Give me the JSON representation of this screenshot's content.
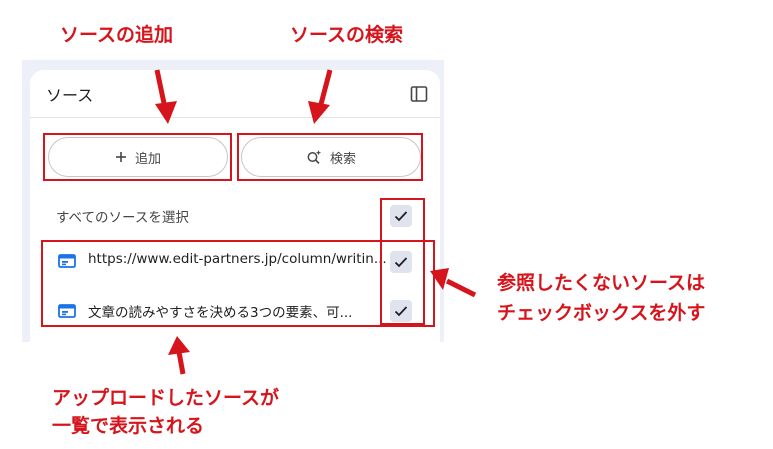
{
  "panel": {
    "title": "ソース",
    "toggle_icon": "panel-toggle-icon"
  },
  "actions": {
    "add_label": "追加",
    "add_icon": "plus-icon",
    "search_label": "検索",
    "search_icon": "sparkle-search-icon"
  },
  "select_all": {
    "label": "すべてのソースを選択",
    "checked": true
  },
  "sources": [
    {
      "title": "https://www.edit-partners.jp/column/writin...",
      "icon": "web-source-icon",
      "checked": true
    },
    {
      "title": "文章の読みやすさを決める3つの要素、可...",
      "icon": "web-source-icon",
      "checked": true
    }
  ],
  "annotations": {
    "add_source": "ソースの追加",
    "search_source": "ソースの検索",
    "uncheck_line1": "参照したくないソースは",
    "uncheck_line2": "チェックボックスを外す",
    "list_line1": "アップロードしたソースが",
    "list_line2": "一覧で表示される"
  },
  "colors": {
    "annotation_red": "#d6141b",
    "accent_blue": "#1a73e8",
    "checkbox_bg": "#dfe3ee"
  }
}
